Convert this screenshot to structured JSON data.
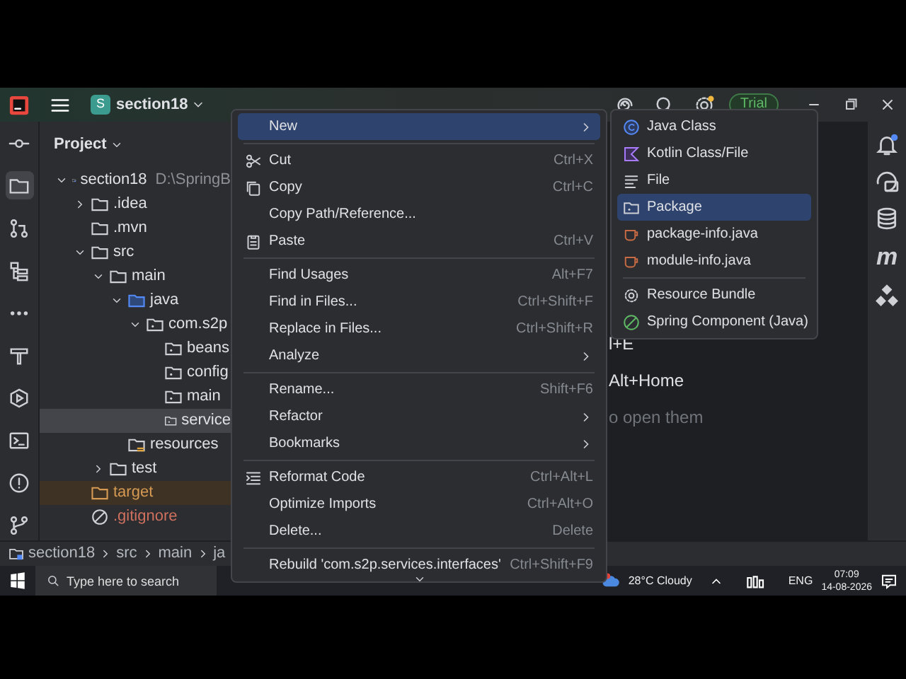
{
  "title_bar": {
    "project_initial": "S",
    "project_name": "section18",
    "trial_badge": "Trial"
  },
  "left_toolbar": [
    {
      "kind": "commit",
      "selected": false
    },
    {
      "kind": "folder",
      "selected": true
    },
    {
      "kind": "pulls",
      "selected": false
    },
    {
      "kind": "structure",
      "selected": false
    },
    {
      "kind": "more",
      "selected": false
    },
    {
      "kind": "hammer",
      "selected": false
    },
    {
      "kind": "services",
      "selected": false
    },
    {
      "kind": "terminal",
      "selected": false
    },
    {
      "kind": "problems",
      "selected": false
    },
    {
      "kind": "git",
      "selected": false
    }
  ],
  "project_panel": {
    "title": "Project",
    "tree": [
      {
        "label": "section18",
        "path": "D:\\SpringB",
        "kind": "module",
        "expanded": true,
        "selected": false,
        "children": [
          {
            "label": ".idea",
            "kind": "folder",
            "expanded": false,
            "selected": false
          },
          {
            "label": ".mvn",
            "kind": "folder",
            "selected": false
          },
          {
            "label": "src",
            "kind": "folder",
            "expanded": true,
            "selected": false,
            "children": [
              {
                "label": "main",
                "kind": "folder",
                "expanded": true,
                "selected": false,
                "children": [
                  {
                    "label": "java",
                    "kind": "source",
                    "expanded": true,
                    "selected": false,
                    "children": [
                      {
                        "label": "com.s2p",
                        "kind": "package",
                        "expanded": true,
                        "selected": false,
                        "children": [
                          {
                            "label": "beans",
                            "kind": "package",
                            "selected": false
                          },
                          {
                            "label": "config",
                            "kind": "package",
                            "selected": false
                          },
                          {
                            "label": "main",
                            "kind": "package",
                            "selected": false
                          },
                          {
                            "label": "service",
                            "kind": "package",
                            "selected": true
                          }
                        ]
                      }
                    ]
                  },
                  {
                    "label": "resources",
                    "kind": "resources",
                    "selected": false
                  }
                ]
              },
              {
                "label": "test",
                "kind": "folder",
                "expanded": false,
                "selected": false
              }
            ]
          },
          {
            "label": "target",
            "kind": "excluded",
            "selected": false
          },
          {
            "label": ".gitignore",
            "kind": "ignored",
            "selected": false
          }
        ]
      }
    ]
  },
  "editor": {
    "hints": [
      {
        "text": "l+E",
        "kind": "shortcut"
      },
      {
        "text": "Alt+Home",
        "kind": "shortcut"
      },
      {
        "text": "o open them",
        "kind": "muted"
      }
    ]
  },
  "right_toolbar": [
    {
      "kind": "bell"
    },
    {
      "kind": "chat"
    },
    {
      "kind": "database"
    },
    {
      "kind": "glyph",
      "text": "m"
    },
    {
      "kind": "blocks"
    }
  ],
  "breadcrumb": [
    "section18",
    "src",
    "main",
    "ja"
  ],
  "context_menu": {
    "groups": [
      [
        {
          "label": "New",
          "kind": "plain",
          "submenu": true,
          "selected": true
        }
      ],
      [
        {
          "label": "Cut",
          "kind": "scissors",
          "shortcut": "Ctrl+X",
          "selected": false
        },
        {
          "label": "Copy",
          "kind": "copy",
          "shortcut": "Ctrl+C",
          "selected": false
        },
        {
          "label": "Copy Path/Reference...",
          "kind": "plain",
          "selected": false
        },
        {
          "label": "Paste",
          "kind": "paste",
          "shortcut": "Ctrl+V",
          "selected": false
        }
      ],
      [
        {
          "label": "Find Usages",
          "kind": "plain",
          "shortcut": "Alt+F7",
          "selected": false
        },
        {
          "label": "Find in Files...",
          "kind": "plain",
          "shortcut": "Ctrl+Shift+F",
          "selected": false
        },
        {
          "label": "Replace in Files...",
          "kind": "plain",
          "shortcut": "Ctrl+Shift+R",
          "selected": false
        },
        {
          "label": "Analyze",
          "kind": "plain",
          "submenu": true,
          "selected": false
        }
      ],
      [
        {
          "label": "Rename...",
          "kind": "plain",
          "shortcut": "Shift+F6",
          "selected": false
        },
        {
          "label": "Refactor",
          "kind": "plain",
          "submenu": true,
          "selected": false
        },
        {
          "label": "Bookmarks",
          "kind": "plain",
          "submenu": true,
          "selected": false
        }
      ],
      [
        {
          "label": "Reformat Code",
          "kind": "reformat",
          "shortcut": "Ctrl+Alt+L",
          "selected": false
        },
        {
          "label": "Optimize Imports",
          "kind": "plain",
          "shortcut": "Ctrl+Alt+O",
          "selected": false
        },
        {
          "label": "Delete...",
          "kind": "plain",
          "shortcut": "Delete",
          "selected": false
        }
      ],
      [
        {
          "label": "Rebuild 'com.s2p.services.interfaces'",
          "kind": "plain",
          "shortcut": "Ctrl+Shift+F9",
          "selected": false
        }
      ]
    ]
  },
  "submenu": {
    "groups": [
      [
        {
          "label": "Java Class",
          "kind": "class",
          "selected": false
        },
        {
          "label": "Kotlin Class/File",
          "kind": "kotlin",
          "selected": false
        },
        {
          "label": "File",
          "kind": "file",
          "selected": false
        },
        {
          "label": "Package",
          "kind": "package",
          "selected": true
        },
        {
          "label": "package-info.java",
          "kind": "javafile",
          "selected": false
        },
        {
          "label": "module-info.java",
          "kind": "javafile",
          "selected": false
        }
      ],
      [
        {
          "label": "Resource Bundle",
          "kind": "bundle",
          "selected": false
        },
        {
          "label": "Spring Component (Java)",
          "kind": "spring",
          "selected": false
        }
      ]
    ]
  },
  "taskbar": {
    "search_placeholder": "Type here to search",
    "weather": "28°C Cloudy",
    "language": "ENG",
    "time": "07:09",
    "date": "14-08-2026"
  }
}
